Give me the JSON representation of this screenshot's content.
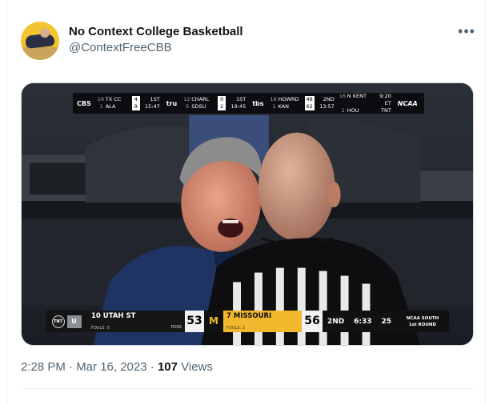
{
  "tweet": {
    "author_name": "No Context College Basketball",
    "author_handle": "@ContextFreeCBB",
    "more_icon": "more-horizontal-icon",
    "timestamp": "2:28 PM · Mar 16, 2023",
    "separator": " · ",
    "views_count": "107",
    "views_label": " Views"
  },
  "ticker": {
    "games": [
      {
        "network": "CBS",
        "rows": [
          {
            "seed": "16",
            "team": "TX CC",
            "score": "4",
            "info": "1ST"
          },
          {
            "seed": "1",
            "team": "ALA",
            "score": "9",
            "info": "15:47"
          }
        ]
      },
      {
        "network": "tru",
        "rows": [
          {
            "seed": "12",
            "team": "CHARL",
            "score": "0",
            "info": "1ST"
          },
          {
            "seed": "5",
            "team": "SDSU",
            "score": "2",
            "info": "19:45"
          }
        ]
      },
      {
        "network": "tbs",
        "rows": [
          {
            "seed": "16",
            "team": "HOWRD",
            "score": "48",
            "info": "2ND"
          },
          {
            "seed": "1",
            "team": "KAN",
            "score": "62",
            "info": "13:57"
          }
        ]
      },
      {
        "network": "",
        "rows": [
          {
            "seed": "16",
            "team": "N KENT",
            "score": "",
            "info": "9:20 ET"
          },
          {
            "seed": "1",
            "team": "HOU",
            "score": "",
            "info": "TNT"
          }
        ]
      }
    ],
    "brand": "NCAA"
  },
  "scoreboard": {
    "network": "TNT",
    "away_logo": "U",
    "away_team": "10 UTAH ST",
    "away_fouls": "FOULS: 5",
    "possession": "POSS",
    "away_score": "53",
    "home_logo": "M",
    "home_team": "7 MISSOURI",
    "home_fouls": "FOULS: 2",
    "home_score": "56",
    "period": "2ND",
    "clock": "6:33",
    "shot_clock": "25",
    "region": "NCAA SOUTH",
    "round": "1st ROUND"
  },
  "colors": {
    "missouri_gold": "#f1b82d",
    "text_secondary": "#536471"
  }
}
